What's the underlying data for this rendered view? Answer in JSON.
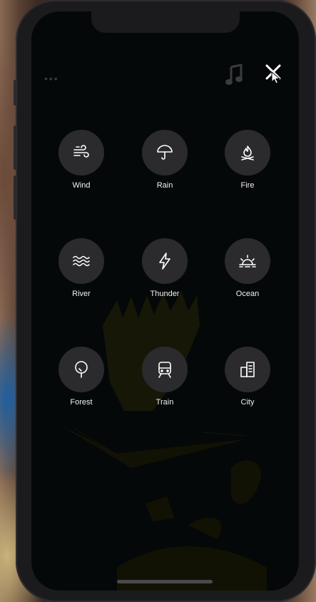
{
  "header": {
    "menu_dots": "•••"
  },
  "sounds": [
    {
      "label": "Wind",
      "icon": "wind-icon"
    },
    {
      "label": "Rain",
      "icon": "umbrella-icon"
    },
    {
      "label": "Fire",
      "icon": "campfire-icon"
    },
    {
      "label": "River",
      "icon": "waves-icon"
    },
    {
      "label": "Thunder",
      "icon": "lightning-icon"
    },
    {
      "label": "Ocean",
      "icon": "sunrise-icon"
    },
    {
      "label": "Forest",
      "icon": "tree-icon"
    },
    {
      "label": "Train",
      "icon": "train-icon"
    },
    {
      "label": "City",
      "icon": "building-icon"
    }
  ],
  "colors": {
    "screen_bg": "#050808",
    "tile_bg": "#2b2b2d",
    "label": "#f2f2f2",
    "art": "#2a2a10"
  }
}
